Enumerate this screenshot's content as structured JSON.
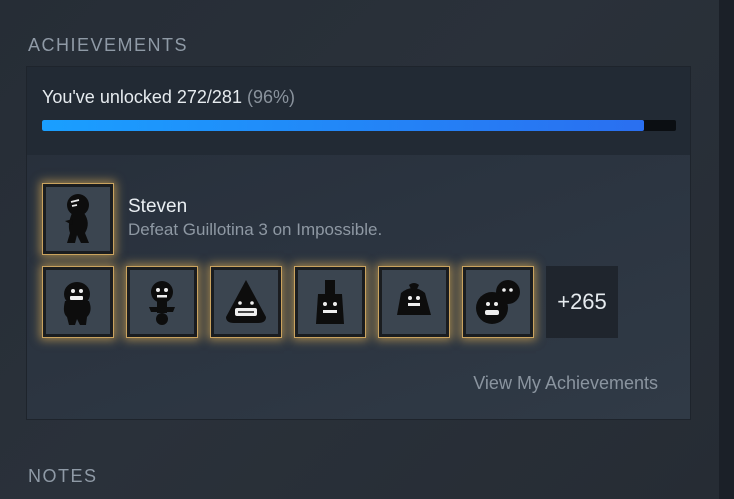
{
  "achievements_section": {
    "title": "ACHIEVEMENTS",
    "progress_prefix": "You've unlocked ",
    "progress_count": "272/281",
    "progress_percent": "(96%)",
    "progress_fraction": 0.95,
    "progress_color": "#1a9fff",
    "recent": {
      "name": "Steven",
      "description": "Defeat Guillotina 3 on Impossible.",
      "icon": "steven-icon"
    },
    "icons": [
      "character-icon-1",
      "character-icon-2",
      "character-icon-3",
      "character-icon-4",
      "character-icon-5",
      "character-icon-6"
    ],
    "more_count": "+265",
    "view_link": "View My Achievements"
  },
  "notes_section": {
    "title": "NOTES"
  }
}
